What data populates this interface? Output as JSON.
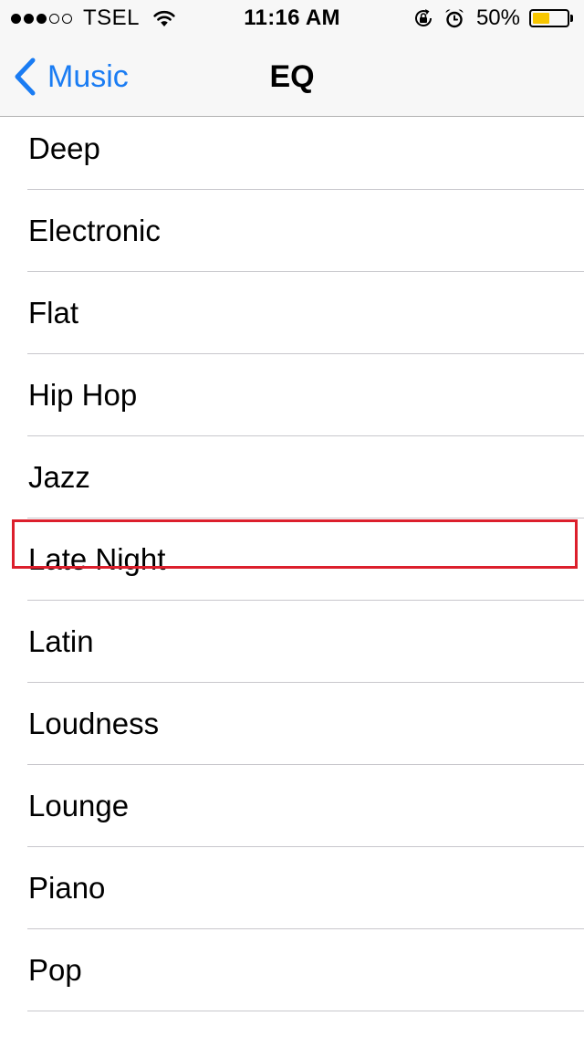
{
  "status_bar": {
    "signal_bars_filled": 3,
    "signal_bars_total": 5,
    "carrier": "TSEL",
    "time": "11:16 AM",
    "battery_percent": "50%",
    "battery_level": 0.5,
    "icons": [
      "wifi-icon",
      "rotation-lock-icon",
      "alarm-icon",
      "battery-icon"
    ]
  },
  "nav": {
    "back_label": "Music",
    "title": "EQ"
  },
  "eq_list": {
    "items": [
      {
        "label": "Deep"
      },
      {
        "label": "Electronic"
      },
      {
        "label": "Flat"
      },
      {
        "label": "Hip Hop"
      },
      {
        "label": "Jazz"
      },
      {
        "label": "Late Night"
      },
      {
        "label": "Latin"
      },
      {
        "label": "Loudness"
      },
      {
        "label": "Lounge"
      },
      {
        "label": "Piano"
      },
      {
        "label": "Pop"
      }
    ],
    "highlighted_item": "Late Night"
  },
  "colors": {
    "accent": "#1a7cf3",
    "highlight": "#dc1f2c",
    "battery_fill": "#f7c600",
    "bar_background": "#f7f7f7",
    "separator": "#c8c7cc"
  }
}
